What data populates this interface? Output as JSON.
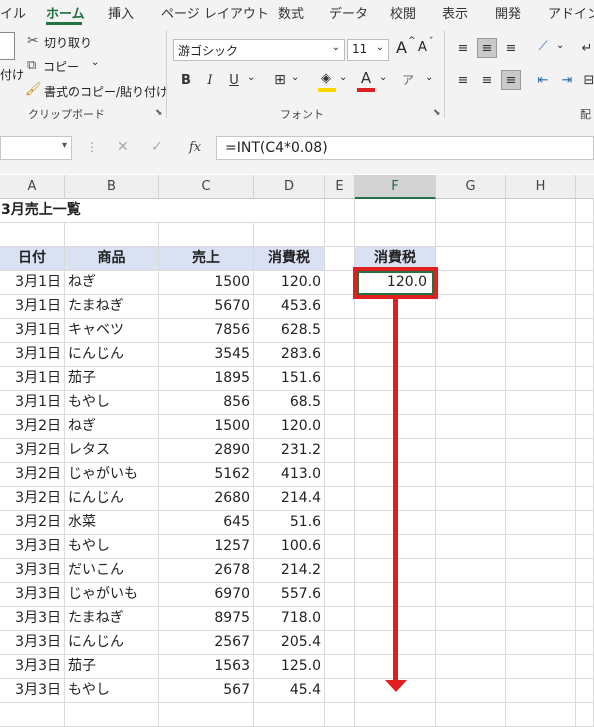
{
  "tabs": [
    "イル",
    "ホーム",
    "挿入",
    "ページ レイアウト",
    "数式",
    "データ",
    "校閲",
    "表示",
    "開発",
    "アドイン"
  ],
  "active_tab": "ホーム",
  "clipboard": {
    "paste_label": "付け",
    "cut_label": "切り取り",
    "copy_label": "コピー",
    "format_painter_label": "書式のコピー/貼り付け",
    "group_label": "クリップボード"
  },
  "font": {
    "name": "游ゴシック",
    "size": "11",
    "group_label": "フォント",
    "grow_label": "A",
    "shrink_label": "A",
    "bold": "B",
    "italic": "I",
    "underline": "U",
    "font_color_letter": "A"
  },
  "alignment": {
    "group_label_partial": "配"
  },
  "formula_bar": {
    "cancel": "✕",
    "enter": "✓",
    "fx": "fx",
    "formula": "=INT(C4*0.08)"
  },
  "columns": [
    "A",
    "B",
    "C",
    "D",
    "E",
    "F",
    "G",
    "H"
  ],
  "selected_column": "F",
  "sheet": {
    "title": "3月売上一覧",
    "headers": {
      "date": "日付",
      "product": "商品",
      "sales": "売上",
      "tax": "消費税"
    },
    "f_header": "消費税",
    "f_value": "120.0",
    "rows": [
      {
        "date": "3月1日",
        "product": "ねぎ",
        "sales": "1500",
        "tax": "120.0"
      },
      {
        "date": "3月1日",
        "product": "たまねぎ",
        "sales": "5670",
        "tax": "453.6"
      },
      {
        "date": "3月1日",
        "product": "キャベツ",
        "sales": "7856",
        "tax": "628.5"
      },
      {
        "date": "3月1日",
        "product": "にんじん",
        "sales": "3545",
        "tax": "283.6"
      },
      {
        "date": "3月1日",
        "product": "茄子",
        "sales": "1895",
        "tax": "151.6"
      },
      {
        "date": "3月1日",
        "product": "もやし",
        "sales": "856",
        "tax": "68.5"
      },
      {
        "date": "3月2日",
        "product": "ねぎ",
        "sales": "1500",
        "tax": "120.0"
      },
      {
        "date": "3月2日",
        "product": "レタス",
        "sales": "2890",
        "tax": "231.2"
      },
      {
        "date": "3月2日",
        "product": "じゃがいも",
        "sales": "5162",
        "tax": "413.0"
      },
      {
        "date": "3月2日",
        "product": "にんじん",
        "sales": "2680",
        "tax": "214.4"
      },
      {
        "date": "3月2日",
        "product": "水菜",
        "sales": "645",
        "tax": "51.6"
      },
      {
        "date": "3月3日",
        "product": "もやし",
        "sales": "1257",
        "tax": "100.6"
      },
      {
        "date": "3月3日",
        "product": "だいこん",
        "sales": "2678",
        "tax": "214.2"
      },
      {
        "date": "3月3日",
        "product": "じゃがいも",
        "sales": "6970",
        "tax": "557.6"
      },
      {
        "date": "3月3日",
        "product": "たまねぎ",
        "sales": "8975",
        "tax": "718.0"
      },
      {
        "date": "3月3日",
        "product": "にんじん",
        "sales": "2567",
        "tax": "205.4"
      },
      {
        "date": "3月3日",
        "product": "茄子",
        "sales": "1563",
        "tax": "125.0"
      },
      {
        "date": "3月3日",
        "product": "もやし",
        "sales": "567",
        "tax": "45.4"
      }
    ]
  },
  "colors": {
    "accent": "#217346",
    "highlight": "#e02020",
    "header_fill": "#d9e1f2"
  }
}
